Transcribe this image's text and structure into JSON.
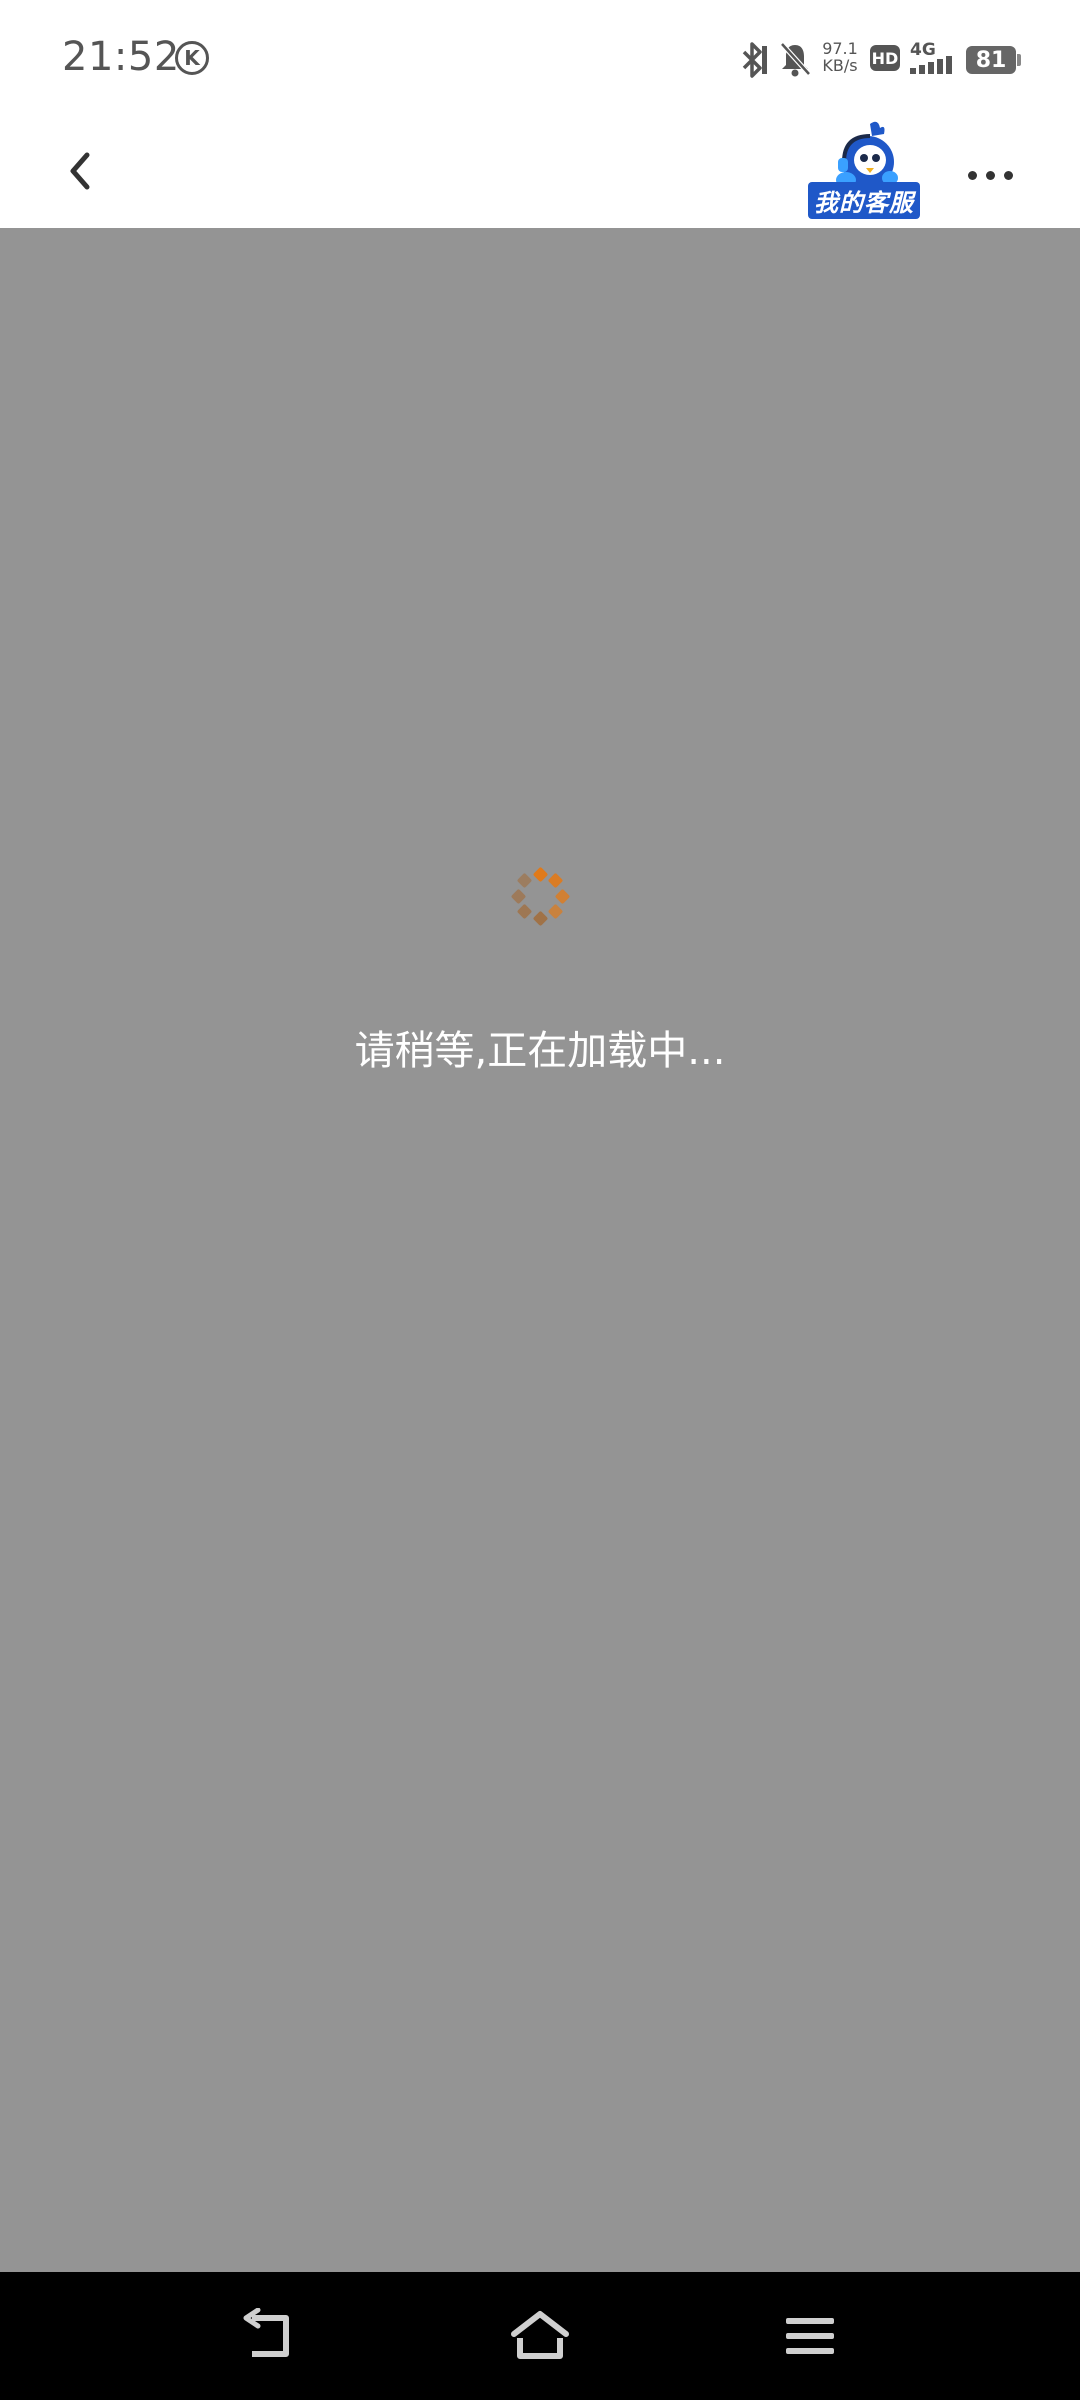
{
  "status_bar": {
    "time": "21:52",
    "k_label": "K",
    "net_speed_value": "97.1",
    "net_speed_unit": "KB/s",
    "hd_label": "HD",
    "network_type": "4G",
    "battery_level": "81",
    "icons": [
      "bluetooth-icon",
      "mute-bell-icon",
      "signal-icon",
      "battery-icon"
    ]
  },
  "header": {
    "logo_text": "我的客服",
    "icons": [
      "back-arrow-icon",
      "more-dots-icon"
    ]
  },
  "content": {
    "loading_text": "请稍等,正在加载中...",
    "spinner_color": "#e07a1a"
  },
  "nav_bar": {
    "icons": [
      "back-nav-icon",
      "home-icon",
      "menu-icon"
    ]
  },
  "colors": {
    "overlay_bg": "#949494",
    "header_bg": "#ffffff",
    "nav_bg": "#000000",
    "logo_blue": "#1f58c8",
    "spinner_orange": "#e07a1a"
  }
}
